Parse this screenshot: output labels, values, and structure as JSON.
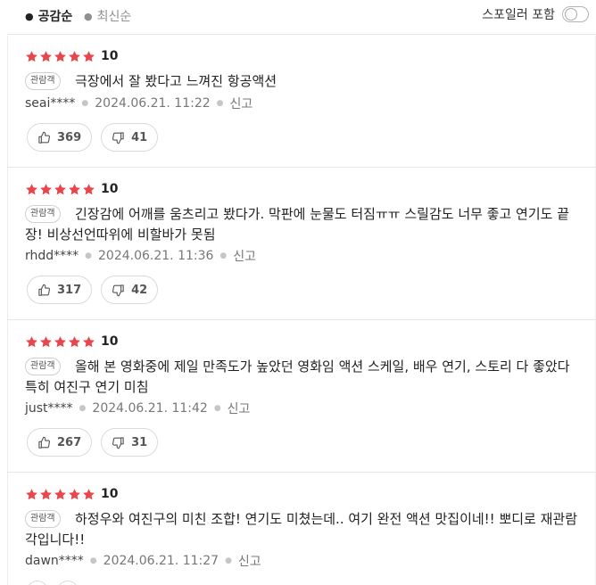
{
  "sort": {
    "active_label": "공감순",
    "inactive_label": "최신순"
  },
  "spoiler": {
    "label": "스포일러 포함",
    "enabled": false
  },
  "colors": {
    "star": "#e8474c",
    "text": "#222222",
    "muted": "#777777"
  },
  "reviews": [
    {
      "rating": 5,
      "score": "10",
      "badge": "관람객",
      "text": "극장에서 잘 봤다고 느껴진 항공액션",
      "user": "seai****",
      "date": "2024.06.21. 11:22",
      "report": "신고",
      "likes": "369",
      "dislikes": "41"
    },
    {
      "rating": 5,
      "score": "10",
      "badge": "관람객",
      "text": "긴장감에 어깨를 움츠리고 봤다가. 막판에 눈물도 터짐ㅠㅠ 스릴감도 너무 좋고 연기도 끝장! 비상선언따위에 비할바가 못됨",
      "user": "rhdd****",
      "date": "2024.06.21. 11:36",
      "report": "신고",
      "likes": "317",
      "dislikes": "42"
    },
    {
      "rating": 5,
      "score": "10",
      "badge": "관람객",
      "text": "올해 본 영화중에 제일 만족도가 높았던 영화임 액션 스케일, 배우 연기, 스토리 다 좋았다 특히 여진구 연기 미침",
      "user": "just****",
      "date": "2024.06.21. 11:42",
      "report": "신고",
      "likes": "267",
      "dislikes": "31"
    },
    {
      "rating": 5,
      "score": "10",
      "badge": "관람객",
      "text": "하정우와 여진구의 미친 조합! 연기도 미쳤는데.. 여기 완전 액션 맛집이네!! 뽀디로 재관람 각입니다!!",
      "user": "dawn****",
      "date": "2024.06.21. 11:27",
      "report": "신고",
      "likes": "",
      "dislikes": ""
    }
  ]
}
